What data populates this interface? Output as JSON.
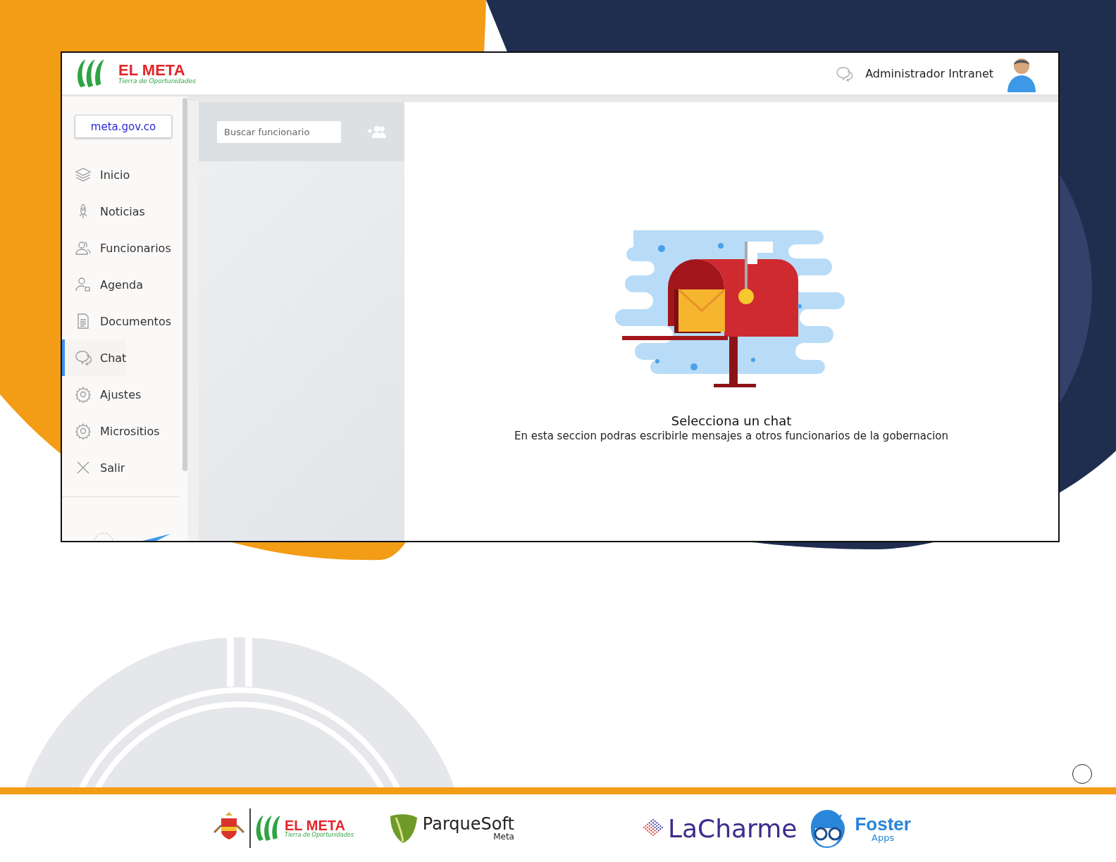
{
  "header": {
    "logo": {
      "title": "EL META",
      "tagline": "Tierra de Oportunidades"
    },
    "user_name": "Administrador Intranet"
  },
  "sidebar": {
    "site_button": "meta.gov.co",
    "items": [
      {
        "label": "Inicio",
        "selected": false
      },
      {
        "label": "Noticias",
        "selected": false
      },
      {
        "label": "Funcionarios",
        "selected": false
      },
      {
        "label": "Agenda",
        "selected": false
      },
      {
        "label": "Documentos",
        "selected": false
      },
      {
        "label": "Chat",
        "selected": true
      },
      {
        "label": "Ajustes",
        "selected": false
      },
      {
        "label": "Micrositios",
        "selected": false
      },
      {
        "label": "Salir",
        "selected": false
      }
    ]
  },
  "contacts": {
    "search": {
      "placeholder": "Buscar funcionario"
    }
  },
  "empty_state": {
    "title": "Selecciona un chat",
    "message": "En esta seccion podras escribirle mensajes a otros funcionarios de la gobernacion"
  },
  "footer": {
    "logos": [
      {
        "kind": "elmeta",
        "title": "EL META",
        "tagline": "Tierra de Oportunidades"
      },
      {
        "kind": "parquesoft",
        "title": "ParqueSoft",
        "subtitle": "Meta"
      },
      {
        "kind": "lacharme",
        "title": "LaCharme"
      },
      {
        "kind": "foster",
        "title": "Foster",
        "subtitle": "Apps"
      }
    ]
  }
}
